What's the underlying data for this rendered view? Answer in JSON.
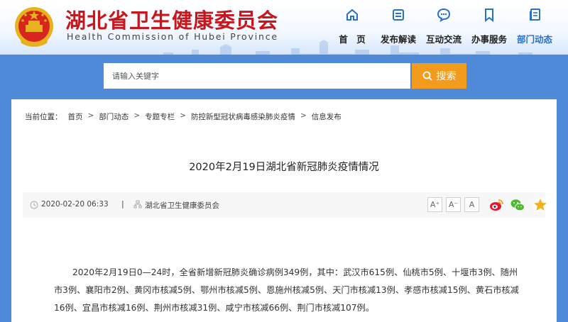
{
  "site": {
    "title": "湖北省卫生健康委员会",
    "subtitle": "Health Commission of Hubei Province"
  },
  "nav": [
    {
      "label": "首　页",
      "icon": "home-icon",
      "active": false
    },
    {
      "label": "发布解读",
      "icon": "document-icon",
      "active": false
    },
    {
      "label": "互动交流",
      "icon": "chat-icon",
      "active": false
    },
    {
      "label": "办事服务",
      "icon": "bookmark-icon",
      "active": false
    },
    {
      "label": "部门动态",
      "icon": "news-icon",
      "active": true
    }
  ],
  "search": {
    "placeholder": "请输入关键字",
    "button_label": "搜索"
  },
  "breadcrumb": {
    "prefix": "当前位置：",
    "items": [
      "首页",
      "部门动态",
      "专题专栏",
      "防控新型冠状病毒感染肺炎疫情",
      "信息发布"
    ]
  },
  "article": {
    "title": "2020年2月19日湖北省新冠肺炎疫情情况",
    "date": "2020-02-20 06:33",
    "separator": "|",
    "source": "湖北省卫生健康委员会",
    "font_sizes": [
      "A⁺",
      "A⁻",
      "A"
    ],
    "share_icons": [
      "weibo-icon",
      "wechat-icon",
      "favorite-star-icon"
    ],
    "body": "2020年2月19日0—24时，全省新增新冠肺炎确诊病例349例，其中：武汉市615例、仙桃市5例、十堰市3例、随州市3例、襄阳市2例、黄冈市核减5例、鄂州市核减5例、恩施州核减5例、天门市核减13例、孝感市核减15例、黄石市核减16例、宜昌市核减16例、荆州市核减31例、咸宁市核减66例、荆门市核减107例。"
  },
  "colors": {
    "brand_red": "#c8161d",
    "nav_active": "#2a70c9",
    "search_button": "#f29b1c",
    "background_blue": "#4f8ad8"
  }
}
